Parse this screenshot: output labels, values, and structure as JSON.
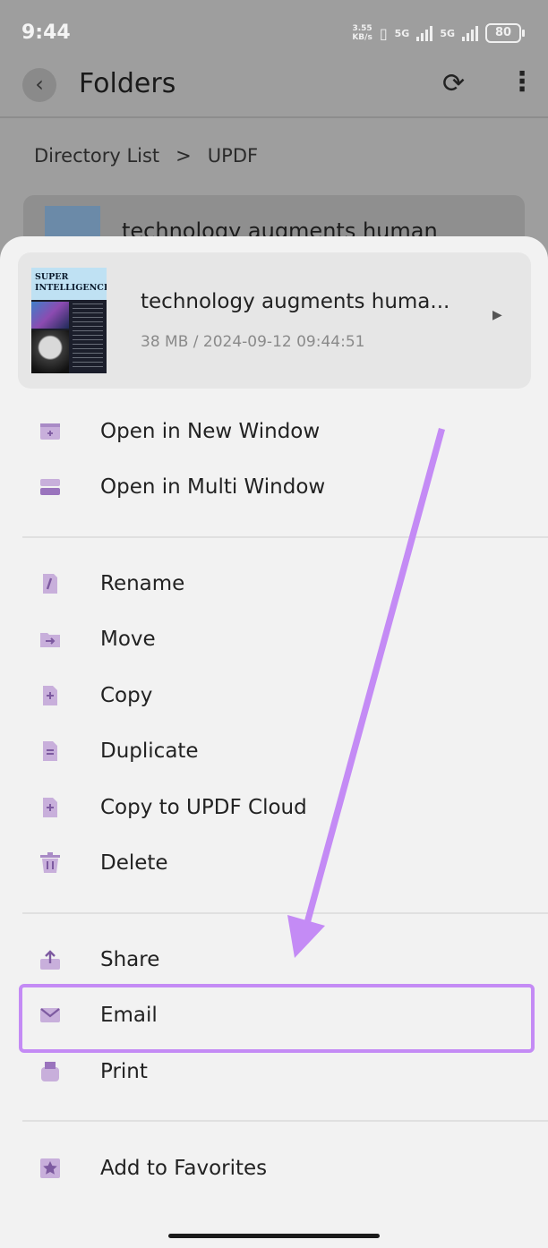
{
  "status_bar": {
    "time": "9:44",
    "net_speed_value": "3.55",
    "net_speed_unit": "KB/s",
    "sig1": "5G",
    "sig2": "5G",
    "battery": "80"
  },
  "app_bar": {
    "title": "Folders",
    "back_icon": "chevron-left-icon",
    "sync_icon": "sync-icon",
    "more_icon": "more-vertical-icon"
  },
  "breadcrumb": {
    "items": [
      "Directory List",
      "UPDF"
    ],
    "separator": ">"
  },
  "background_file": {
    "title": "technology augments human"
  },
  "sheet": {
    "file": {
      "thumb_line1": "SUPER",
      "thumb_line2": "INTELLIGENCE",
      "name": "technology augments huma...",
      "meta": "38 MB / 2024-09-12 09:44:51"
    },
    "groups": [
      [
        {
          "label": "Open in New Window",
          "icon": "new-window-icon"
        },
        {
          "label": "Open in Multi Window",
          "icon": "multi-window-icon"
        }
      ],
      [
        {
          "label": "Rename",
          "icon": "pencil-icon"
        },
        {
          "label": "Move",
          "icon": "folder-move-icon"
        },
        {
          "label": "Copy",
          "icon": "file-plus-icon"
        },
        {
          "label": "Duplicate",
          "icon": "file-duplicate-icon"
        },
        {
          "label": "Copy to UPDF Cloud",
          "icon": "file-plus-icon"
        },
        {
          "label": "Delete",
          "icon": "trash-icon"
        }
      ],
      [
        {
          "label": "Share",
          "icon": "share-icon"
        },
        {
          "label": "Email",
          "icon": "mail-icon"
        },
        {
          "label": "Print",
          "icon": "printer-icon"
        }
      ],
      [
        {
          "label": "Add to Favorites",
          "icon": "star-icon"
        }
      ]
    ]
  },
  "colors": {
    "icon_accent": "#c8afdb",
    "icon_dark": "#7d5aa0",
    "annotation": "#c48bf5"
  }
}
